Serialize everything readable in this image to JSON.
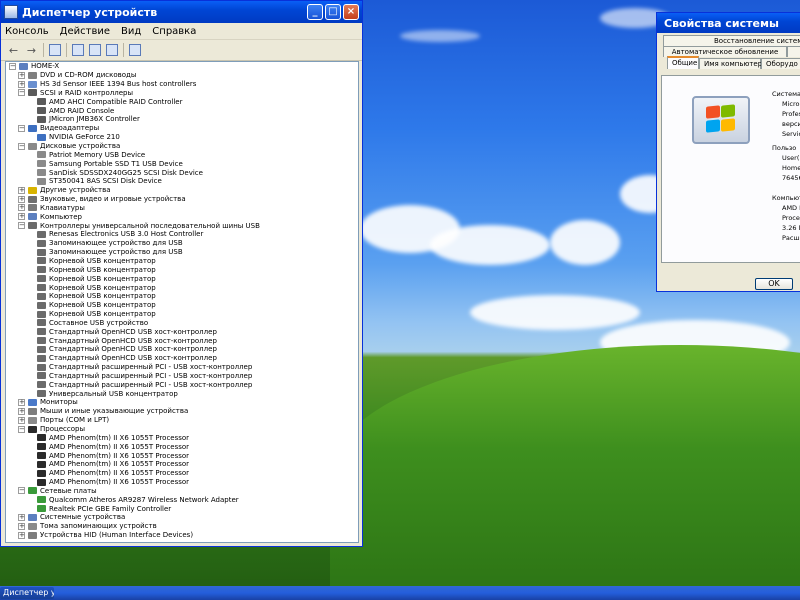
{
  "device_manager": {
    "title": "Диспетчер устройств",
    "menu": [
      "Консоль",
      "Действие",
      "Вид",
      "Справка"
    ],
    "tree": [
      {
        "level": 0,
        "exp": "−",
        "icon": "computer-icon",
        "color": "#5c7fbf",
        "text": "HOME-X"
      },
      {
        "level": 1,
        "exp": "+",
        "icon": "dvd-drive-icon",
        "color": "#7f7f7f",
        "text": "DVD и CD-ROM дисководы"
      },
      {
        "level": 1,
        "exp": "+",
        "icon": "firewire-icon",
        "color": "#6a8fcf",
        "text": "HS 3d Sensor IEEE 1394 Bus host controllers"
      },
      {
        "level": 1,
        "exp": "−",
        "icon": "scsi-controller-icon",
        "color": "#5b5b5b",
        "text": "SCSI и RAID контроллеры"
      },
      {
        "level": 2,
        "exp": "",
        "icon": "scsi-controller-icon",
        "color": "#5b5b5b",
        "text": "AMD AHCI Compatible RAID Controller"
      },
      {
        "level": 2,
        "exp": "",
        "icon": "scsi-controller-icon",
        "color": "#5b5b5b",
        "text": "AMD RAID Console"
      },
      {
        "level": 2,
        "exp": "",
        "icon": "scsi-controller-icon",
        "color": "#5b5b5b",
        "text": "JMicron JMB36X Controller"
      },
      {
        "level": 1,
        "exp": "−",
        "icon": "display-adapter-icon",
        "color": "#3d6fc0",
        "text": "Видеоадаптеры"
      },
      {
        "level": 2,
        "exp": "",
        "icon": "display-adapter-icon",
        "color": "#3d6fc0",
        "text": "NVIDIA GeForce 210"
      },
      {
        "level": 1,
        "exp": "−",
        "icon": "disk-drive-icon",
        "color": "#8a8a8a",
        "text": "Дисковые устройства"
      },
      {
        "level": 2,
        "exp": "",
        "icon": "disk-drive-icon",
        "color": "#8a8a8a",
        "text": "Patriot Memory USB Device"
      },
      {
        "level": 2,
        "exp": "",
        "icon": "disk-drive-icon",
        "color": "#8a8a8a",
        "text": "Samsung Portable SSD T1 USB Device"
      },
      {
        "level": 2,
        "exp": "",
        "icon": "disk-drive-icon",
        "color": "#8a8a8a",
        "text": "SanDisk SDSSDX240GG25 SCSI Disk Device"
      },
      {
        "level": 2,
        "exp": "",
        "icon": "disk-drive-icon",
        "color": "#8a8a8a",
        "text": "ST350041 8AS SCSI Disk Device"
      },
      {
        "level": 1,
        "exp": "+",
        "icon": "unknown-device-icon",
        "color": "#d9b400",
        "text": "Другие устройства"
      },
      {
        "level": 1,
        "exp": "+",
        "icon": "sound-icon",
        "color": "#6f6f6f",
        "text": "Звуковые, видео и игровые устройства"
      },
      {
        "level": 1,
        "exp": "+",
        "icon": "keyboard-icon",
        "color": "#7a7a7a",
        "text": "Клавиатуры"
      },
      {
        "level": 1,
        "exp": "+",
        "icon": "computer-icon",
        "color": "#5c7fbf",
        "text": "Компьютер"
      },
      {
        "level": 1,
        "exp": "−",
        "icon": "usb-controller-icon",
        "color": "#6b6b6b",
        "text": "Контроллеры универсальной последовательной шины USB"
      },
      {
        "level": 2,
        "exp": "",
        "icon": "usb-controller-icon",
        "color": "#6b6b6b",
        "text": "Renesas Electronics USB 3.0 Host Controller"
      },
      {
        "level": 2,
        "exp": "",
        "icon": "usb-controller-icon",
        "color": "#6b6b6b",
        "text": "Запоминающее устройство для USB"
      },
      {
        "level": 2,
        "exp": "",
        "icon": "usb-controller-icon",
        "color": "#6b6b6b",
        "text": "Запоминающее устройство для USB"
      },
      {
        "level": 2,
        "exp": "",
        "icon": "usb-controller-icon",
        "color": "#6b6b6b",
        "text": "Корневой USB концентратор"
      },
      {
        "level": 2,
        "exp": "",
        "icon": "usb-controller-icon",
        "color": "#6b6b6b",
        "text": "Корневой USB концентратор"
      },
      {
        "level": 2,
        "exp": "",
        "icon": "usb-controller-icon",
        "color": "#6b6b6b",
        "text": "Корневой USB концентратор"
      },
      {
        "level": 2,
        "exp": "",
        "icon": "usb-controller-icon",
        "color": "#6b6b6b",
        "text": "Корневой USB концентратор"
      },
      {
        "level": 2,
        "exp": "",
        "icon": "usb-controller-icon",
        "color": "#6b6b6b",
        "text": "Корневой USB концентратор"
      },
      {
        "level": 2,
        "exp": "",
        "icon": "usb-controller-icon",
        "color": "#6b6b6b",
        "text": "Корневой USB концентратор"
      },
      {
        "level": 2,
        "exp": "",
        "icon": "usb-controller-icon",
        "color": "#6b6b6b",
        "text": "Корневой USB концентратор"
      },
      {
        "level": 2,
        "exp": "",
        "icon": "usb-controller-icon",
        "color": "#6b6b6b",
        "text": "Составное USB устройство"
      },
      {
        "level": 2,
        "exp": "",
        "icon": "usb-controller-icon",
        "color": "#6b6b6b",
        "text": "Стандартный OpenHCD USB хост-контроллер"
      },
      {
        "level": 2,
        "exp": "",
        "icon": "usb-controller-icon",
        "color": "#6b6b6b",
        "text": "Стандартный OpenHCD USB хост-контроллер"
      },
      {
        "level": 2,
        "exp": "",
        "icon": "usb-controller-icon",
        "color": "#6b6b6b",
        "text": "Стандартный OpenHCD USB хост-контроллер"
      },
      {
        "level": 2,
        "exp": "",
        "icon": "usb-controller-icon",
        "color": "#6b6b6b",
        "text": "Стандартный OpenHCD USB хост-контроллер"
      },
      {
        "level": 2,
        "exp": "",
        "icon": "usb-controller-icon",
        "color": "#6b6b6b",
        "text": "Стандартный расширенный PCI - USB хост-контроллер"
      },
      {
        "level": 2,
        "exp": "",
        "icon": "usb-controller-icon",
        "color": "#6b6b6b",
        "text": "Стандартный расширенный PCI - USB хост-контроллер"
      },
      {
        "level": 2,
        "exp": "",
        "icon": "usb-controller-icon",
        "color": "#6b6b6b",
        "text": "Стандартный расширенный PCI - USB хост-контроллер"
      },
      {
        "level": 2,
        "exp": "",
        "icon": "usb-controller-icon",
        "color": "#6b6b6b",
        "text": "Универсальный USB концентратор"
      },
      {
        "level": 1,
        "exp": "+",
        "icon": "monitor-icon",
        "color": "#4a79c9",
        "text": "Мониторы"
      },
      {
        "level": 1,
        "exp": "+",
        "icon": "mouse-icon",
        "color": "#7d7d7d",
        "text": "Мыши и иные указывающие устройства"
      },
      {
        "level": 1,
        "exp": "+",
        "icon": "port-icon",
        "color": "#8a8a8a",
        "text": "Порты (COM и LPT)"
      },
      {
        "level": 1,
        "exp": "−",
        "icon": "processor-icon",
        "color": "#2b2b2b",
        "text": "Процессоры"
      },
      {
        "level": 2,
        "exp": "",
        "icon": "processor-icon",
        "color": "#2b2b2b",
        "text": "AMD Phenom(tm) II X6 1055T Processor"
      },
      {
        "level": 2,
        "exp": "",
        "icon": "processor-icon",
        "color": "#2b2b2b",
        "text": "AMD Phenom(tm) II X6 1055T Processor"
      },
      {
        "level": 2,
        "exp": "",
        "icon": "processor-icon",
        "color": "#2b2b2b",
        "text": "AMD Phenom(tm) II X6 1055T Processor"
      },
      {
        "level": 2,
        "exp": "",
        "icon": "processor-icon",
        "color": "#2b2b2b",
        "text": "AMD Phenom(tm) II X6 1055T Processor"
      },
      {
        "level": 2,
        "exp": "",
        "icon": "processor-icon",
        "color": "#2b2b2b",
        "text": "AMD Phenom(tm) II X6 1055T Processor"
      },
      {
        "level": 2,
        "exp": "",
        "icon": "processor-icon",
        "color": "#2b2b2b",
        "text": "AMD Phenom(tm) II X6 1055T Processor"
      },
      {
        "level": 1,
        "exp": "−",
        "icon": "network-adapter-icon",
        "color": "#3a9a3a",
        "text": "Сетевые платы"
      },
      {
        "level": 2,
        "exp": "",
        "icon": "network-adapter-icon",
        "color": "#3a9a3a",
        "text": "Qualcomm Atheros AR9287 Wireless Network Adapter"
      },
      {
        "level": 2,
        "exp": "",
        "icon": "network-adapter-icon",
        "color": "#3a9a3a",
        "text": "Realtek PCIe GBE Family Controller"
      },
      {
        "level": 1,
        "exp": "+",
        "icon": "system-device-icon",
        "color": "#5c7fbf",
        "text": "Системные устройства"
      },
      {
        "level": 1,
        "exp": "+",
        "icon": "volume-icon",
        "color": "#8a8a8a",
        "text": "Тома запоминающих устройств"
      },
      {
        "level": 1,
        "exp": "+",
        "icon": "hid-icon",
        "color": "#7d7d7d",
        "text": "Устройства HID (Human Interface Devices)"
      }
    ]
  },
  "system_properties": {
    "title": "Свойства системы",
    "tabs_row1": [
      "Восстановление системы"
    ],
    "tabs_row2": [
      "Автоматическое обновление",
      ""
    ],
    "tabs_row3": [
      "Общие",
      "Имя компьютера",
      "Оборудо"
    ],
    "labels": {
      "system": "Система",
      "sys1": "Micro",
      "sys2": "Profes",
      "sys3": "верси",
      "sys4": "Service",
      "user_header": "Пользо",
      "user1": "User(R",
      "user2": "Home",
      "user3": "76456-",
      "computer_header": "Компьютер",
      "comp1": "AMD P",
      "comp2": "Proces",
      "comp3": "3.26 ГГ",
      "comp4": "Расши"
    },
    "ok_label": "OK"
  },
  "taskbar": {
    "item_label": "Диспетчер устройств"
  }
}
